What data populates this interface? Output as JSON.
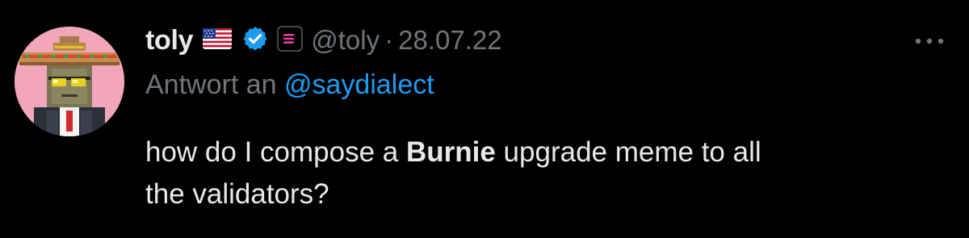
{
  "tweet": {
    "author_name": "toly",
    "handle": "@toly",
    "separator": "·",
    "date": "28.07.22",
    "reply_prefix": "Antwort an",
    "reply_mention": "@saydialect",
    "text_before": "how do I compose a ",
    "text_bold": "Burnie",
    "text_after_line1": " upgrade meme to all",
    "text_line2": "the validators?",
    "icons": {
      "flag": "us-flag-icon",
      "verified": "verified-badge-icon",
      "affiliation": "solana-logo-icon",
      "more": "more-dots-icon"
    },
    "colors": {
      "background": "#000000",
      "text": "#e7e9ea",
      "muted": "#71767b",
      "link": "#1d9bf0",
      "avatar_bg": "#f2a6b9"
    }
  }
}
